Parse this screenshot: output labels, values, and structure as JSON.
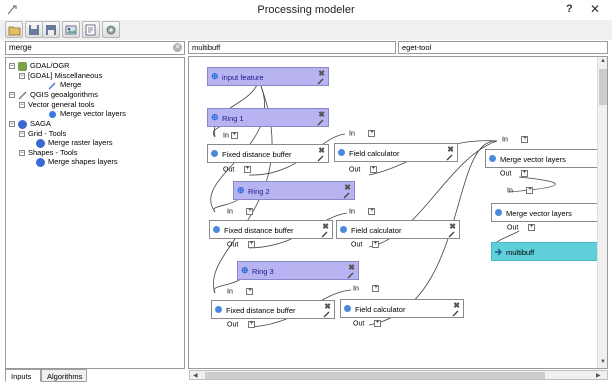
{
  "window": {
    "title": "Processing modeler",
    "help": "?",
    "close": "✕"
  },
  "toolbar": {
    "buttons": [
      {
        "name": "open-model-button",
        "icon": "folder-icon"
      },
      {
        "name": "save-model-button",
        "icon": "save-icon"
      },
      {
        "name": "save-as-model-button",
        "icon": "save-as-icon"
      },
      {
        "name": "export-image-button",
        "icon": "export-image-icon"
      },
      {
        "name": "edit-help-button",
        "icon": "edit-help-icon"
      },
      {
        "name": "run-model-button",
        "icon": "run-icon"
      }
    ]
  },
  "search": {
    "value": "merge",
    "clear": "✕"
  },
  "tree": {
    "items": [
      {
        "label": "GDAL/OGR",
        "level": 0,
        "expander": "−",
        "icon": "gdal-icon"
      },
      {
        "label": "[GDAL] Miscellaneous",
        "level": 1,
        "expander": "−"
      },
      {
        "label": "Merge",
        "level": 2,
        "icon": "algorithm-icon"
      },
      {
        "label": "QGIS geoalgorithms",
        "level": 0,
        "expander": "−",
        "icon": "qgis-icon"
      },
      {
        "label": "Vector general tools",
        "level": 1,
        "expander": "−"
      },
      {
        "label": "Merge vector layers",
        "level": 2,
        "icon": "algorithm-icon"
      },
      {
        "label": "SAGA",
        "level": 0,
        "expander": "−",
        "icon": "saga-icon"
      },
      {
        "label": "Grid - Tools",
        "level": 1,
        "expander": "−"
      },
      {
        "label": "Merge raster layers",
        "level": 2,
        "icon": "algorithm-icon"
      },
      {
        "label": "Shapes - Tools",
        "level": 1,
        "expander": "−"
      },
      {
        "label": "Merge shapes layers",
        "level": 2,
        "icon": "algorithm-icon"
      }
    ]
  },
  "tabs": [
    {
      "label": "Inputs"
    },
    {
      "label": "Algorithms"
    }
  ],
  "model": {
    "name": "multibuff",
    "group": "eget-tool"
  },
  "canvas": {
    "ports": {
      "in": "In",
      "out": "Out",
      "expand": "+"
    },
    "nodes": [
      {
        "id": "input-feature",
        "label": "input feature",
        "kind": "input"
      },
      {
        "id": "ring-1",
        "label": "Ring 1",
        "kind": "input"
      },
      {
        "id": "ring-2",
        "label": "Ring 2",
        "kind": "input"
      },
      {
        "id": "ring-3",
        "label": "Ring 3",
        "kind": "input"
      },
      {
        "id": "fdb-1",
        "label": "Fixed distance buffer",
        "kind": "alg"
      },
      {
        "id": "fdb-2",
        "label": "Fixed distance buffer",
        "kind": "alg"
      },
      {
        "id": "fdb-3",
        "label": "Fixed distance buffer",
        "kind": "alg"
      },
      {
        "id": "fc-1",
        "label": "Field calculator",
        "kind": "alg"
      },
      {
        "id": "fc-2",
        "label": "Field calculator",
        "kind": "alg"
      },
      {
        "id": "fc-3",
        "label": "Field calculator",
        "kind": "alg"
      },
      {
        "id": "mvl-1",
        "label": "Merge vector layers",
        "kind": "alg"
      },
      {
        "id": "mvl-2",
        "label": "Merge vector layers",
        "kind": "alg"
      },
      {
        "id": "output",
        "label": "multibuff",
        "kind": "output"
      }
    ]
  },
  "colors": {
    "input_node": "#b8b4f2",
    "output_node": "#5fd0da",
    "alg_dot": "#4a8ad8"
  }
}
